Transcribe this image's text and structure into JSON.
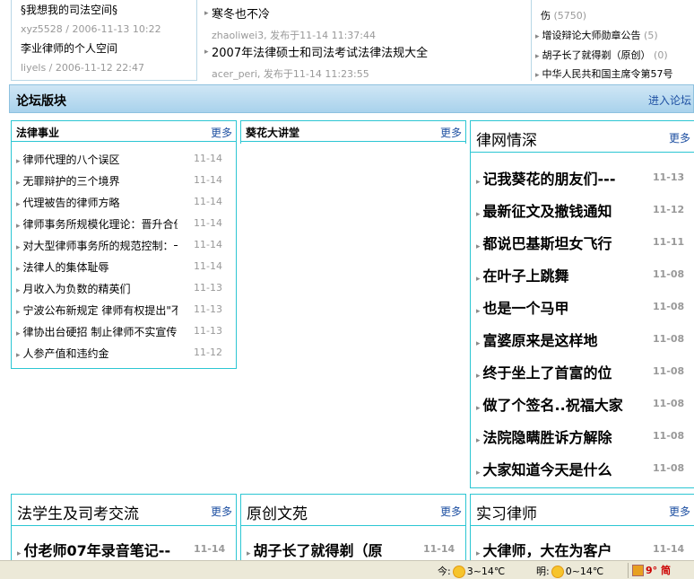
{
  "top_left": {
    "items": [
      {
        "title": "§我想我的司法空间§",
        "meta": "xyz5528 / 2006-11-13 10:22"
      },
      {
        "title": "李业律师的个人空间",
        "meta": "liyels / 2006-11-12 22:47"
      }
    ]
  },
  "top_mid": {
    "items": [
      {
        "title": "寒冬也不冷",
        "meta": "zhaoliwei3, 发布于11-14 11:37:44"
      },
      {
        "title": "2007年法律硕士和司法考试法律法规大全",
        "meta": "acer_peri, 发布于11-14 11:23:55"
      }
    ]
  },
  "top_right": {
    "items": [
      {
        "title": "伤",
        "count": "(5750)"
      },
      {
        "title": "增设辩论大师勋章公告",
        "count": "(5)"
      },
      {
        "title": "胡子长了就得剃（原创）",
        "count": "(0)"
      },
      {
        "title": "中华人民共和国主席令第57号",
        "count": ""
      }
    ]
  },
  "forum_bar": {
    "title": "论坛版块",
    "enter": "进入论坛"
  },
  "panels": {
    "law": {
      "title": "法律事业",
      "more": "更多",
      "rows": [
        {
          "text": "律师代理的八个误区",
          "date": "11-14"
        },
        {
          "text": "无罪辩护的三个境界",
          "date": "11-14"
        },
        {
          "text": "代理被告的律师方略",
          "date": "11-14"
        },
        {
          "text": "律师事务所规模化理论：晋升合伙",
          "date": "11-14"
        },
        {
          "text": "对大型律师事务所的规范控制：一",
          "date": "11-14"
        },
        {
          "text": "法律人的集体耻辱",
          "date": "11-14"
        },
        {
          "text": "月收入为负数的精英们",
          "date": "11-13"
        },
        {
          "text": "宁波公布新规定 律师有权提出\"不",
          "date": "11-13"
        },
        {
          "text": "律协出台硬招 制止律师不实宣传",
          "date": "11-13"
        },
        {
          "text": "人参产值和违约金",
          "date": "11-12"
        }
      ]
    },
    "kuihua": {
      "title": "葵花大讲堂",
      "more": "更多"
    },
    "lvwang": {
      "title": "律网情深",
      "more": "更多",
      "rows": [
        {
          "text": "记我葵花的朋友们---",
          "date": "11-13"
        },
        {
          "text": "最新征文及撤钱通知",
          "date": "11-12"
        },
        {
          "text": "都说巴基斯坦女飞行",
          "date": "11-11"
        },
        {
          "text": "在叶子上跳舞",
          "date": "11-08"
        },
        {
          "text": "也是一个马甲",
          "date": "11-08"
        },
        {
          "text": "富婆原来是这样地",
          "date": "11-08"
        },
        {
          "text": "终于坐上了首富的位",
          "date": "11-08"
        },
        {
          "text": "做了个签名..祝福大家",
          "date": "11-08"
        },
        {
          "text": "法院隐瞒胜诉方解除",
          "date": "11-08"
        },
        {
          "text": "大家知道今天是什么",
          "date": "11-08"
        }
      ]
    },
    "student": {
      "title": "法学生及司考交流",
      "more": "更多",
      "rows": [
        {
          "text": "付老师07年录音笔记--",
          "date": "11-14"
        }
      ]
    },
    "original": {
      "title": "原创文苑",
      "more": "更多",
      "rows": [
        {
          "text": "胡子长了就得剃（原",
          "date": "11-14"
        }
      ]
    },
    "intern": {
      "title": "实习律师",
      "more": "更多",
      "rows": [
        {
          "text": "大律师，大在为客户",
          "date": "11-14"
        }
      ]
    }
  },
  "status": {
    "today_label": "今:",
    "today_temp": "3~14℃",
    "tomorrow_label": "明:",
    "tomorrow_temp": "0~14℃",
    "extra": "9° 简"
  }
}
